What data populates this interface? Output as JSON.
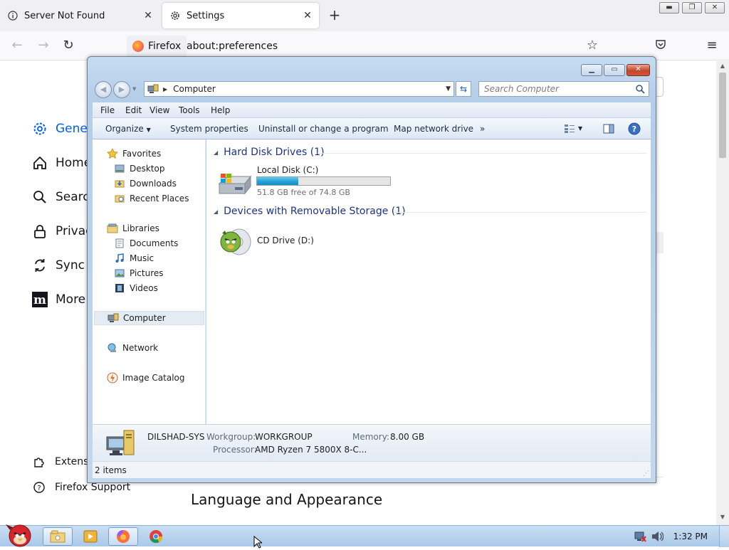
{
  "browser": {
    "tabs": [
      {
        "title": "Server Not Found",
        "icon": "info-icon"
      },
      {
        "title": "Settings",
        "icon": "gear-icon"
      }
    ],
    "identity_label": "Firefox",
    "url": "about:preferences"
  },
  "settings_page": {
    "nav": [
      {
        "label": "Genera",
        "icon": "gear-icon"
      },
      {
        "label": "Home",
        "icon": "home-icon"
      },
      {
        "label": "Search",
        "icon": "search-icon"
      },
      {
        "label": "Privacy",
        "icon": "lock-icon"
      },
      {
        "label": "Sync",
        "icon": "sync-icon"
      },
      {
        "label": "More f",
        "icon": "mozilla-icon"
      }
    ],
    "footer": [
      {
        "label": "Extensio",
        "icon": "puzzle-icon"
      },
      {
        "label": "Firefox Support",
        "icon": "help-icon"
      }
    ],
    "section_heading": "Language and Appearance"
  },
  "explorer": {
    "address": "Computer",
    "search_placeholder": "Search Computer",
    "menu": [
      "File",
      "Edit",
      "View",
      "Tools",
      "Help"
    ],
    "commands": [
      "Organize",
      "System properties",
      "Uninstall or change a program",
      "Map network drive",
      "»"
    ],
    "nav_pane": {
      "favorites": "Favorites",
      "favorite_items": [
        "Desktop",
        "Downloads",
        "Recent Places"
      ],
      "libraries": "Libraries",
      "library_items": [
        "Documents",
        "Music",
        "Pictures",
        "Videos"
      ],
      "computer": "Computer",
      "network": "Network",
      "image_catalog": "Image Catalog"
    },
    "groups": {
      "hard_disks": "Hard Disk Drives (1)",
      "removable": "Devices with Removable Storage (1)"
    },
    "local_disk": {
      "name": "Local Disk (C:)",
      "free_text": "51.8 GB free of 74.8 GB",
      "used_fraction": 0.31
    },
    "cd_drive": {
      "name": "CD Drive (D:)"
    },
    "details": {
      "computer_name": "DILSHAD-SYS",
      "workgroup_label": "Workgroup:",
      "workgroup": "WORKGROUP",
      "memory_label": "Memory:",
      "memory": "8.00 GB",
      "processor_label": "Processor:",
      "processor": "AMD Ryzen 7 5800X 8-C..."
    },
    "status": "2 items"
  },
  "taskbar": {
    "time": "1:32 PM",
    "apps": [
      "angry-bird-start-icon",
      "file-explorer-icon",
      "media-player-icon",
      "firefox-icon",
      "chrome-icon"
    ]
  },
  "colors": {
    "firefox_accent": "#0061e0",
    "disk_bar_fill": "#26a0da",
    "group_heading": "#1e3287"
  }
}
